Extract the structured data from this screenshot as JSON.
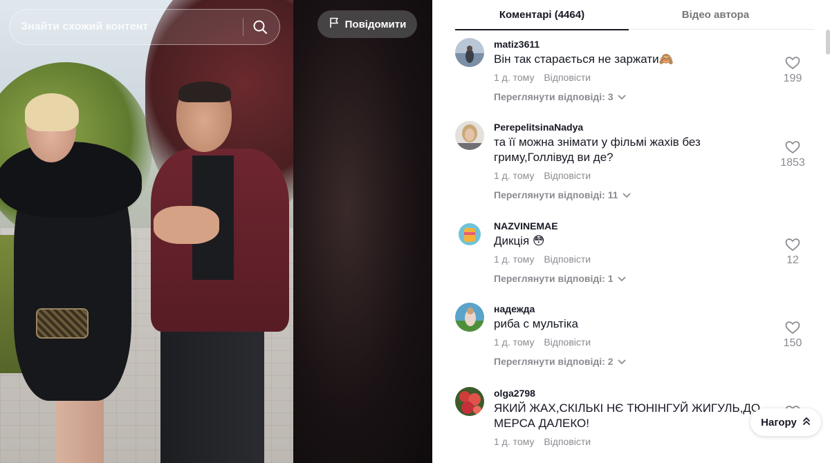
{
  "video": {
    "search": {
      "placeholder": "Знайти схожий контент",
      "icon": "search-icon"
    },
    "report": {
      "label": "Повідомити",
      "icon": "flag-icon"
    }
  },
  "comments_panel": {
    "tabs": [
      {
        "label": "Коментарі (4464)",
        "active": true
      },
      {
        "label": "Відео автора",
        "active": false
      }
    ],
    "comments": [
      {
        "username": "matiz3611",
        "text": "Він так старається не заржати🙈",
        "time": "1 д. тому",
        "reply_label": "Відповісти",
        "view_replies": "Переглянути відповіді: 3",
        "likes": "199"
      },
      {
        "username": "PerepelitsinaNadya",
        "text": "та її можна знімати у фільмі жахів без гриму,Голлівуд ви де?",
        "time": "1 д. тому",
        "reply_label": "Відповісти",
        "view_replies": "Переглянути відповіді: 11",
        "likes": "1853"
      },
      {
        "username": "NAZVINEMAE",
        "text": "Дикція 😳",
        "time": "1 д. тому",
        "reply_label": "Відповісти",
        "view_replies": "Переглянути відповіді: 1",
        "likes": "12"
      },
      {
        "username": "надежда",
        "text": "риба с мультіка",
        "time": "1 д. тому",
        "reply_label": "Відповісти",
        "view_replies": "Переглянути відповіді: 2",
        "likes": "150"
      },
      {
        "username": "olga2798",
        "text": "ЯКИЙ ЖАХ,СКІЛЬКІ НЄ ТЮНІНГУЙ ЖИГУЛЬ,ДО МЕРСА ДАЛЕКО!",
        "time": "1 д. тому",
        "reply_label": "Відповісти",
        "view_replies": "",
        "likes": ""
      }
    ],
    "scroll_top": {
      "label": "Нагору",
      "icon": "double-chevron-up-icon"
    }
  },
  "colors": {
    "text_primary": "#161823",
    "text_secondary": "#8a8b91",
    "report_bg": "#545454"
  }
}
